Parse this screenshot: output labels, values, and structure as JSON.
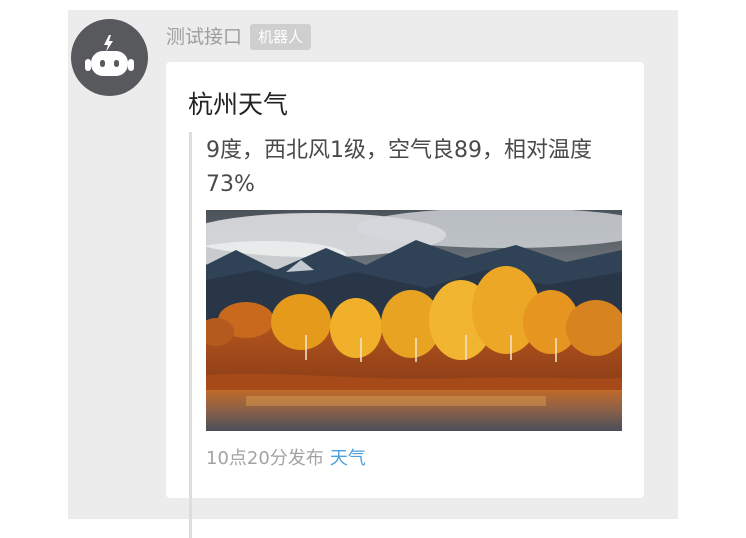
{
  "message": {
    "sender_name": "测试接口",
    "sender_badge": "机器人",
    "avatar_icon": "robot-icon",
    "card": {
      "title": "杭州天气",
      "description": "9度，西北风1级，空气良89，相对温度73%",
      "image_icon": "autumn-landscape-photo",
      "footer_time": "10点20分发布",
      "footer_link": "天气",
      "link_color": "#4ea1dd"
    }
  }
}
